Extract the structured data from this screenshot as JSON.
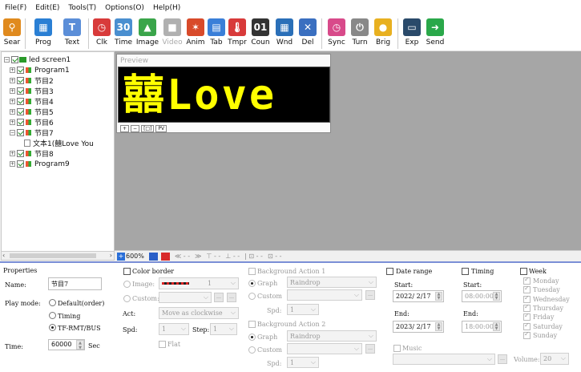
{
  "menu": [
    "File(F)",
    "Edit(E)",
    "Tools(T)",
    "Options(O)",
    "Help(H)"
  ],
  "toolbar": [
    {
      "label": "Sear",
      "icon": "search-icon",
      "color": "#e08a1e"
    },
    {
      "label": "Prog",
      "icon": "program-icon",
      "color": "#2a7fd4"
    },
    {
      "label": "Text",
      "icon": "text-icon",
      "color": "#5b8ed8"
    },
    {
      "label": "Clk",
      "icon": "clock-icon",
      "color": "#d83a3a"
    },
    {
      "label": "Time",
      "icon": "calendar-icon",
      "color": "#4a8fd0"
    },
    {
      "label": "Image",
      "icon": "image-icon",
      "color": "#3aa54a"
    },
    {
      "label": "Video",
      "icon": "video-icon",
      "color": "#b0b0b0",
      "disabled": true
    },
    {
      "label": "Anim",
      "icon": "animation-icon",
      "color": "#d84a2a"
    },
    {
      "label": "Tab",
      "icon": "table-icon",
      "color": "#3a7fd8"
    },
    {
      "label": "Tmpr",
      "icon": "thermometer-icon",
      "color": "#d83a3a"
    },
    {
      "label": "Coun",
      "icon": "counter-icon",
      "color": "#333333"
    },
    {
      "label": "Wnd",
      "icon": "window-icon",
      "color": "#2a6fb8"
    },
    {
      "label": "Del",
      "icon": "delete-icon",
      "color": "#3a6fc0"
    },
    {
      "label": "Sync",
      "icon": "sync-icon",
      "color": "#d84a8a"
    },
    {
      "label": "Turn",
      "icon": "power-icon",
      "color": "#888888"
    },
    {
      "label": "Brig",
      "icon": "bulb-icon",
      "color": "#e8b020"
    },
    {
      "label": "Exp",
      "icon": "export-icon",
      "color": "#2a4a6a"
    },
    {
      "label": "Send",
      "icon": "send-icon",
      "color": "#2aa84a"
    }
  ],
  "tree": {
    "root": "led screen1",
    "items": [
      "Program1",
      "节目2",
      "节目3",
      "节目4",
      "节目5",
      "节目6",
      "节目7"
    ],
    "child": "文本1(囍Love You",
    "items2": [
      "节目8",
      "Program9"
    ]
  },
  "preview": {
    "title": "Preview",
    "led_text": "囍Love",
    "tools": [
      "+",
      "−",
      "[□]",
      "PV"
    ],
    "text_color": "#ffff00"
  },
  "canvas_strip": {
    "zoom": "600%"
  },
  "props": {
    "title": "Properties",
    "name_label": "Name:",
    "name_value": "节目7",
    "play_mode_label": "Play mode:",
    "play_modes": [
      "Default(order)",
      "Timing",
      "TF-RMT/BUS"
    ],
    "time_label": "Time:",
    "time_value": "60000",
    "time_unit": "Sec",
    "color_border": "Color border",
    "image_label": "Image:",
    "image_num": "1",
    "custom_label": "Custom:",
    "act_label": "Act:",
    "act_value": "Move as clockwise",
    "spd_label": "Spd:",
    "spd_value": "1",
    "step_label": "Step:",
    "step_value": "1",
    "flat_label": "Flat",
    "bg1_title": "Background Action 1",
    "bg2_title": "Background Action 2",
    "graph_label": "Graph",
    "graph_value": "Raindrop",
    "bg_custom": "Custom",
    "bg_spd": "Spd:",
    "bg_spd_value": "1",
    "date_range": "Date range",
    "start_label": "Start:",
    "start_date": "2022/ 2/17",
    "end_label": "End:",
    "end_date": "2023/ 2/17",
    "timing": "Timing",
    "start_time": "08:00:00",
    "end_time": "18:00:00",
    "week": "Week",
    "days": [
      "Monday",
      "Tuesday",
      "Wednesday",
      "Thursday",
      "Friday",
      "Saturday",
      "Sunday"
    ],
    "music": "Music",
    "volume_label": "Volume:",
    "volume_value": "20"
  }
}
